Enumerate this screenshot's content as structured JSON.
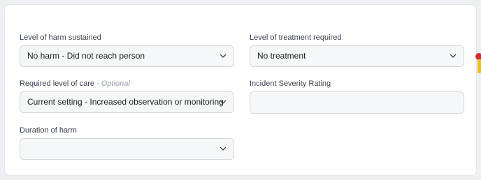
{
  "colors": {
    "marker_dot": "#e0262b",
    "marker_bar": "#f4c20d"
  },
  "fields": {
    "harm_sustained": {
      "label": "Level of harm sustained",
      "value": "No harm - Did not reach person"
    },
    "treatment_required": {
      "label": "Level of treatment required",
      "value": "No treatment"
    },
    "care_level": {
      "label": "Required level of care",
      "optional": "- Optional",
      "value": "Current setting - Increased observation or monitoring"
    },
    "severity_rating": {
      "label": "Incident Severity Rating",
      "value": ""
    },
    "duration_of_harm": {
      "label": "Duration of harm",
      "value": ""
    }
  },
  "icons": {
    "dropdown": "chevron-down-icon"
  }
}
